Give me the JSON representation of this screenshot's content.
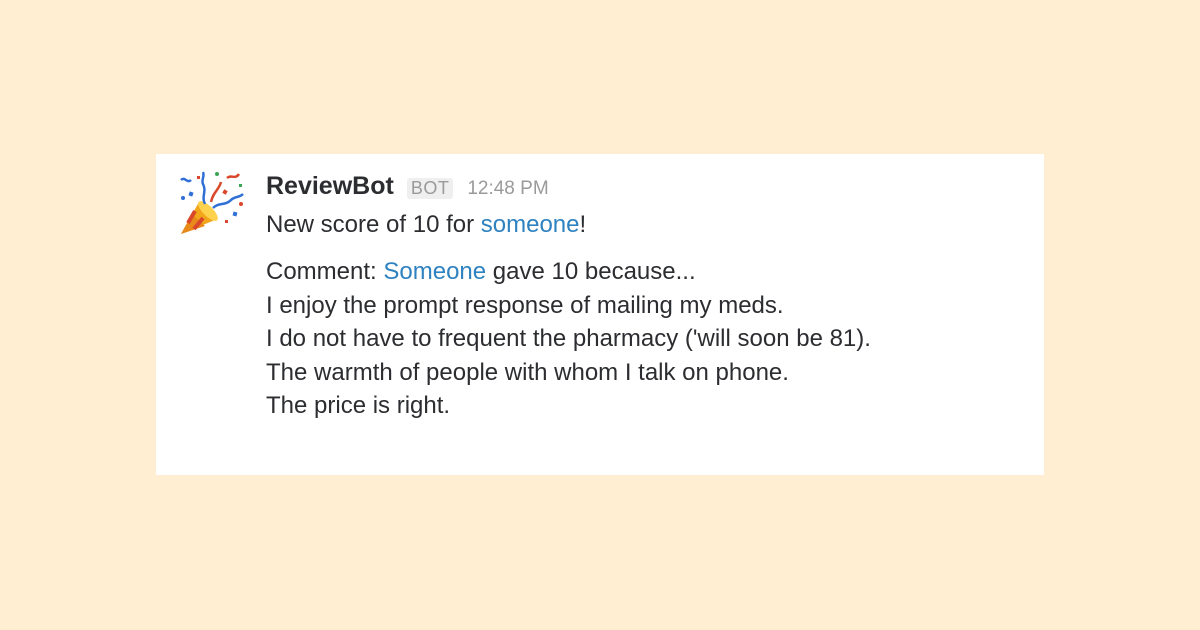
{
  "message": {
    "sender": "ReviewBot",
    "badge": "BOT",
    "time": "12:48 PM",
    "avatar_icon": "party-popper-icon",
    "score_line": {
      "prefix": "New score of 10 for ",
      "link": "someone",
      "suffix": "!"
    },
    "comment_line": {
      "prefix": "Comment: ",
      "link": "Someone",
      "suffix": " gave 10 because..."
    },
    "comment_lines": [
      "I enjoy the prompt response of mailing my meds.",
      "I do not have to frequent the pharmacy ('will soon be 81).",
      "The warmth of people with whom I talk on phone.",
      "The price is right."
    ]
  },
  "colors": {
    "background": "#ffeed2",
    "card": "#ffffff",
    "link": "#2f82c0",
    "text": "#2c2d30",
    "muted": "#9a9a9a"
  }
}
